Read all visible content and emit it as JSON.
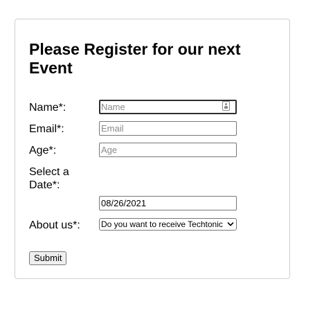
{
  "form": {
    "title": "Please Register for our next Event",
    "name": {
      "label": "Name*:",
      "placeholder": "Name",
      "value": ""
    },
    "email": {
      "label": "Email*:",
      "placeholder": "Email",
      "value": ""
    },
    "age": {
      "label": "Age*:",
      "placeholder": "Age",
      "value": ""
    },
    "date": {
      "label": "Select a Date*:",
      "value": "08/26/2021"
    },
    "about": {
      "label": "About us*:",
      "selected": "Do you want to receive Techtonic updates?"
    },
    "submit_label": "Submit"
  },
  "colors": {
    "card_border": "#cfcfcf",
    "input_border": "#767676",
    "focused_border": "#2d2d2d",
    "button_bg": "#efefef"
  },
  "icons": {
    "name_field_icon": "contact-card-icon",
    "select_icon": "chevron-down-icon"
  }
}
